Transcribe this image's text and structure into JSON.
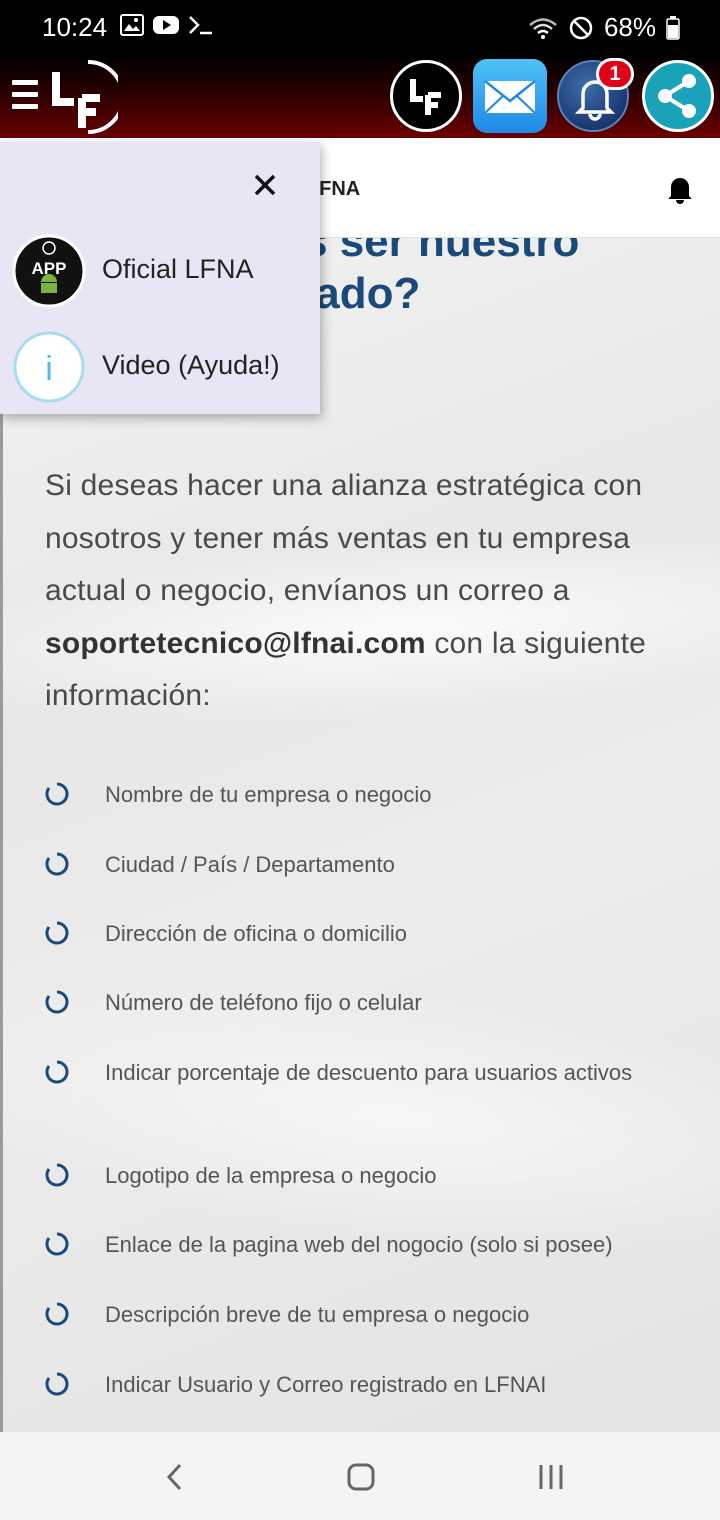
{
  "status_bar": {
    "time": "10:24",
    "battery": "68%",
    "left_icons": [
      "image-icon",
      "youtube-icon",
      "terminal-icon"
    ],
    "right_icons": [
      "wifi-icon",
      "do-not-disturb-icon",
      "battery-icon"
    ]
  },
  "header": {
    "logo_text": "LF",
    "notification_count": "1",
    "buttons": [
      "lf-app-icon",
      "mail-icon",
      "bell-icon",
      "share-icon"
    ]
  },
  "subheader": {
    "title_visible": "cial LFNA"
  },
  "drawer": {
    "close_symbol": "✕",
    "items": [
      {
        "label": "Oficial LFNA",
        "icon": "android-app-icon",
        "icon_text": "APP"
      },
      {
        "label": "Video (Ayuda!)",
        "icon": "info-icon",
        "icon_text": "i"
      }
    ]
  },
  "content": {
    "heading_line1": "s ser nuestro",
    "heading_line2": "iado?",
    "intro_before": "Si deseas hacer una alianza estratégica con nosotros y tener más ventas en tu empresa actual o negocio, envíanos un correo a ",
    "email": "soportetecnico@lfnai.com",
    "intro_after": " con la siguiente información:",
    "requirements": [
      "Nombre de tu empresa o negocio",
      "Ciudad / País / Departamento",
      "Dirección de oficina o domicilio",
      "Número de teléfono fijo o celular",
      "Indicar porcentaje de descuento para usuarios activos",
      "Logotipo de la empresa o negocio",
      "Enlace de la pagina web del nogocio (solo si posee)",
      "Descripción breve de tu empresa o negocio",
      "Indicar Usuario y Correo registrado en LFNAI"
    ]
  },
  "colors": {
    "heading": "#1a4a7a",
    "ring": "#1a4a7a",
    "header_gradient_end": "#6a0000",
    "badge": "#e0001a",
    "drawer_bg": "#e8e6f4"
  },
  "nav": [
    "back-icon",
    "home-icon",
    "recents-icon"
  ]
}
